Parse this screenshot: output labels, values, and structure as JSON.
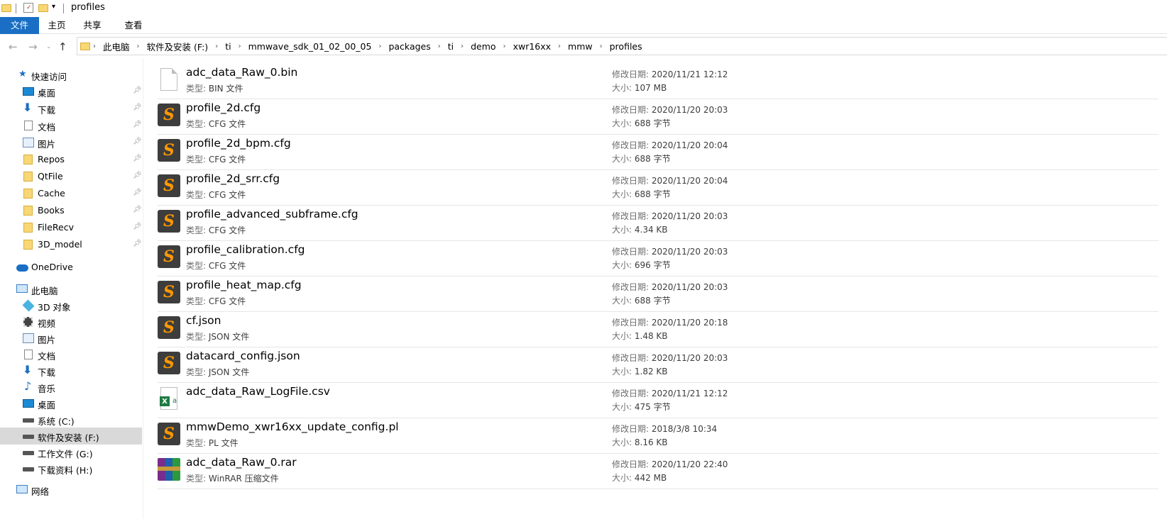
{
  "window": {
    "title": "profiles"
  },
  "ribbon": {
    "tabs": [
      "文件",
      "主页",
      "共享",
      "查看"
    ]
  },
  "address": {
    "path": [
      "此电脑",
      "软件及安装 (F:)",
      "ti",
      "mmwave_sdk_01_02_00_05",
      "packages",
      "ti",
      "demo",
      "xwr16xx",
      "mmw",
      "profiles"
    ]
  },
  "nav": {
    "quick_access": "快速访问",
    "quick_items": [
      "桌面",
      "下载",
      "文档",
      "图片",
      "Repos",
      "QtFile",
      "Cache",
      "Books",
      "FileRecv",
      "3D_model"
    ],
    "onedrive": "OneDrive",
    "this_pc": "此电脑",
    "pc_items": [
      "3D 对象",
      "视频",
      "图片",
      "文档",
      "下载",
      "音乐",
      "桌面",
      "系统 (C:)",
      "软件及安装 (F:)",
      "工作文件 (G:)",
      "下载资料 (H:)"
    ],
    "network": "网络",
    "selected": "软件及安装 (F:)"
  },
  "labels": {
    "type": "类型:",
    "modified": "修改日期:",
    "size": "大小:"
  },
  "files": [
    {
      "name": "adc_data_Raw_0.bin",
      "type": "BIN 文件",
      "date": "2020/11/21 12:12",
      "size": "107 MB",
      "icon": "blank-file-icon"
    },
    {
      "name": "profile_2d.cfg",
      "type": "CFG 文件",
      "date": "2020/11/20 20:03",
      "size": "688 字节",
      "icon": "sublime-icon"
    },
    {
      "name": "profile_2d_bpm.cfg",
      "type": "CFG 文件",
      "date": "2020/11/20 20:04",
      "size": "688 字节",
      "icon": "sublime-icon"
    },
    {
      "name": "profile_2d_srr.cfg",
      "type": "CFG 文件",
      "date": "2020/11/20 20:04",
      "size": "688 字节",
      "icon": "sublime-icon"
    },
    {
      "name": "profile_advanced_subframe.cfg",
      "type": "CFG 文件",
      "date": "2020/11/20 20:03",
      "size": "4.34 KB",
      "icon": "sublime-icon"
    },
    {
      "name": "profile_calibration.cfg",
      "type": "CFG 文件",
      "date": "2020/11/20 20:03",
      "size": "696 字节",
      "icon": "sublime-icon"
    },
    {
      "name": "profile_heat_map.cfg",
      "type": "CFG 文件",
      "date": "2020/11/20 20:03",
      "size": "688 字节",
      "icon": "sublime-icon"
    },
    {
      "name": "cf.json",
      "type": "JSON 文件",
      "date": "2020/11/20 20:18",
      "size": "1.48 KB",
      "icon": "sublime-icon"
    },
    {
      "name": "datacard_config.json",
      "type": "JSON 文件",
      "date": "2020/11/20 20:03",
      "size": "1.82 KB",
      "icon": "sublime-icon"
    },
    {
      "name": "adc_data_Raw_LogFile.csv",
      "type": "",
      "date": "2020/11/21 12:12",
      "size": "475 字节",
      "icon": "excel-icon"
    },
    {
      "name": "mmwDemo_xwr16xx_update_config.pl",
      "type": "PL 文件",
      "date": "2018/3/8 10:34",
      "size": "8.16 KB",
      "icon": "sublime-icon"
    },
    {
      "name": "adc_data_Raw_0.rar",
      "type": "WinRAR 压缩文件",
      "date": "2020/11/20 22:40",
      "size": "442 MB",
      "icon": "winrar-icon"
    }
  ]
}
